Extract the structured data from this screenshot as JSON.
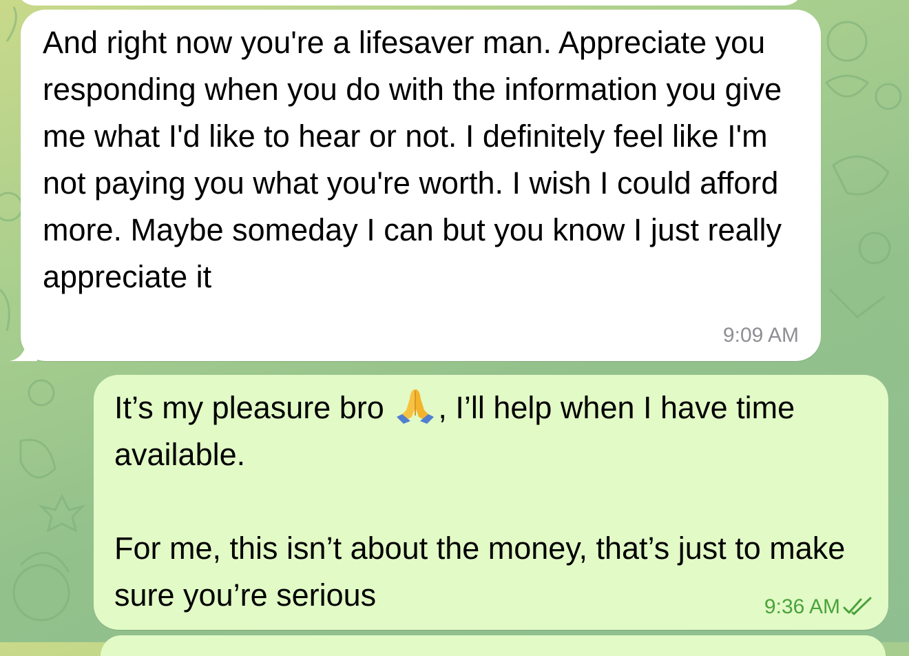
{
  "chat": {
    "incoming": {
      "text": "And right now you're a lifesaver man. Appreciate you responding when you do with the information you give me what I'd like to hear or not. I definitely feel like I'm not paying you what you're worth. I wish I could afford more. Maybe someday I can but you know I just really appreciate it",
      "time": "9:09 AM"
    },
    "outgoing": {
      "text_before_emoji": "It’s my pleasure bro ",
      "emoji": "folded-hands-emoji",
      "text_after_emoji": ", I’ll help when I have time available.\n\nFor me, this isn’t about the money, that’s just to make sure you’re serious",
      "time": "9:36 AM",
      "status": "read"
    }
  },
  "colors": {
    "incoming_bubble": "#ffffff",
    "outgoing_bubble": "#e2fac6",
    "outgoing_time": "#4aa23c",
    "incoming_time": "#8e8e93",
    "wallpaper": "#a9cf8e"
  }
}
